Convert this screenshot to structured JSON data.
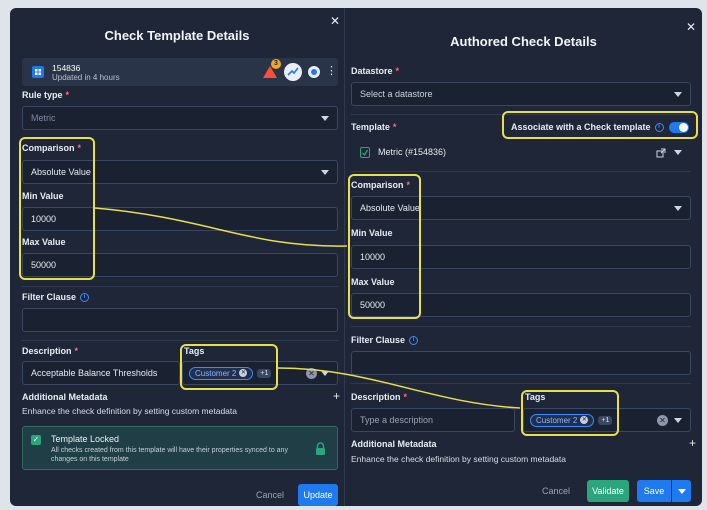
{
  "left": {
    "title": "Check Template Details",
    "template_card": {
      "id": "154836",
      "subtitle": "Updated in 4 hours",
      "alert_count": "3"
    },
    "rule_type": {
      "label": "Rule type",
      "value": "Metric"
    },
    "comparison": {
      "label": "Comparison",
      "value": "Absolute Value"
    },
    "min_value": {
      "label": "Min Value",
      "value": "10000"
    },
    "max_value": {
      "label": "Max Value",
      "value": "50000"
    },
    "filter_clause": {
      "label": "Filter Clause",
      "value": ""
    },
    "description": {
      "label": "Description",
      "value": "Acceptable Balance Thresholds"
    },
    "tags": {
      "label": "Tags",
      "chip": "Customer 2",
      "more": "+1"
    },
    "additional_metadata": {
      "label": "Additional Metadata",
      "subtitle": "Enhance the check definition by setting custom metadata",
      "add": "+"
    },
    "template_locked": {
      "title": "Template Locked",
      "text": "All checks created from this template will have their properties synced to any changes on this template"
    },
    "cancel": "Cancel",
    "update": "Update"
  },
  "right": {
    "title": "Authored Check Details",
    "datastore": {
      "label": "Datastore",
      "placeholder": "Select a datastore"
    },
    "template": {
      "label": "Template",
      "value": "Metric (#154836)"
    },
    "associate": {
      "label": "Associate with a Check template"
    },
    "comparison": {
      "label": "Comparison",
      "value": "Absolute Value"
    },
    "min_value": {
      "label": "Min Value",
      "value": "10000"
    },
    "max_value": {
      "label": "Max Value",
      "value": "50000"
    },
    "filter_clause": {
      "label": "Filter Clause",
      "value": ""
    },
    "description": {
      "label": "Description",
      "placeholder": "Type a description"
    },
    "tags": {
      "label": "Tags",
      "chip": "Customer 2",
      "more": "+1"
    },
    "additional_metadata": {
      "label": "Additional Metadata",
      "subtitle": "Enhance the check definition by setting custom metadata",
      "add": "+"
    },
    "cancel": "Cancel",
    "validate": "Validate",
    "save": "Save"
  },
  "colors": {
    "panel_bg": "#1e2637",
    "accent_blue": "#1f7af0",
    "highlight": "#e8df4a",
    "locked_green": "#2aa57c",
    "required": "#ff6b8a"
  }
}
